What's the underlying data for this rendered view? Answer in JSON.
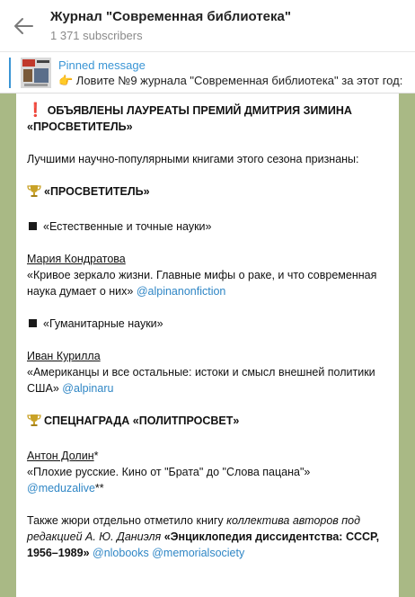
{
  "header": {
    "title": "Журнал \"Современная библиотека\"",
    "subscribers": "1 371 subscribers"
  },
  "pinned": {
    "label": "Pinned message",
    "text": "👉 Ловите №9 журнала \"Современная библиотека\" за этот год:"
  },
  "post": {
    "heading": "ОБЪЯВЛЕНЫ ЛАУРЕАТЫ ПРЕМИЙ ДМИТРИЯ ЗИМИНА «ПРОСВЕТИТЕЛЬ»",
    "intro": "Лучшими научно-популярными книгами этого сезона признаны:",
    "prize1": "«ПРОСВЕТИТЕЛЬ»",
    "cat1": "«Естественные и точные науки»",
    "author1": "Мария Кондратова",
    "book1": "«Кривое зеркало жизни. Главные мифы о раке, и что современная наука думает о них»",
    "link1": "@alpinanonfiction",
    "cat2": "«Гуманитарные науки»",
    "author2": "Иван Курилла",
    "book2": "«Американцы и все остальные: истоки и смысл внешней политики США»",
    "link2": "@alpinaru",
    "prize2": "СПЕЦНАГРАДА «ПОЛИТПРОСВЕТ»",
    "author3": "Антон Долин",
    "author3_mark": "*",
    "book3": "«Плохие русские. Кино от \"Брата\" до \"Слова пацана\"»",
    "link3": "@meduzalive",
    "link3_mark": "**",
    "final_plain": "Также жюри отдельно отметило книгу",
    "final_italic": "коллектива авторов под редакцией А. Ю. Даниэля",
    "final_bold": "«Энциклопедия диссидентства: СССР, 1956–1989»",
    "link4": "@nlobooks",
    "link5": "@memorialsociety"
  }
}
